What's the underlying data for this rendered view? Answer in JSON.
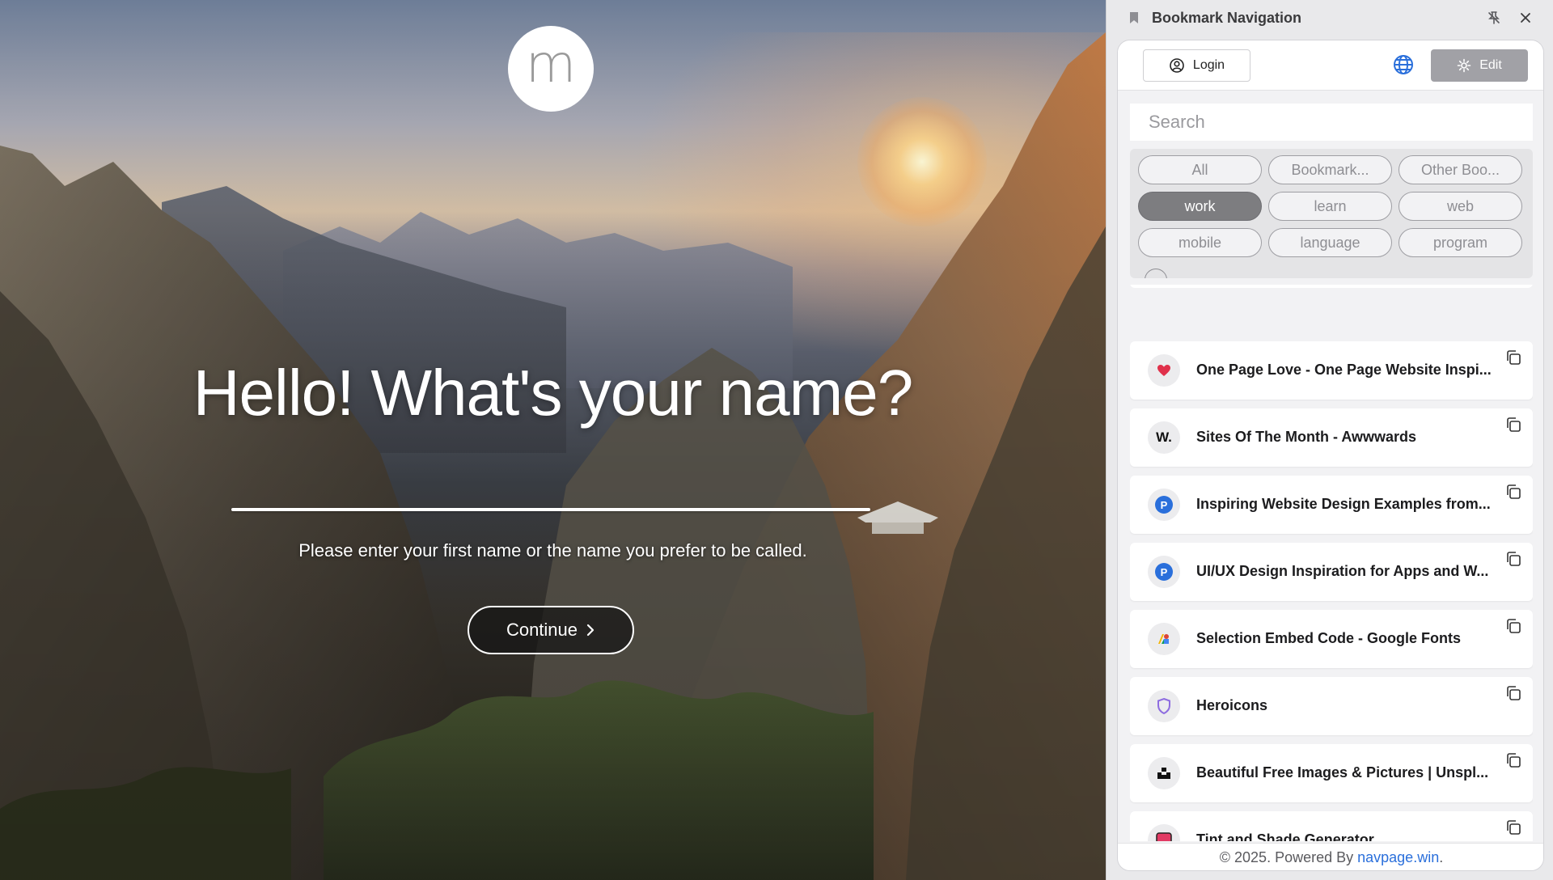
{
  "colors": {
    "accent_blue": "#2a6fdb",
    "active_tag_bg": "#7d7d80",
    "edit_button_bg": "#a1a1a6",
    "panel_bg": "#f2f2f4"
  },
  "welcome": {
    "logo_letter": "m",
    "greeting": "Hello! What's your name?",
    "name_input_value": "",
    "hint": "Please enter your first name or the name you prefer to be called.",
    "continue_label": "Continue"
  },
  "panel": {
    "title": "Bookmark Navigation",
    "login_label": "Login",
    "edit_label": "Edit",
    "search_placeholder": "Search",
    "tags": [
      {
        "label": "All",
        "active": false
      },
      {
        "label": "Bookmark...",
        "active": false
      },
      {
        "label": "Other Boo...",
        "active": false
      },
      {
        "label": "work",
        "active": true
      },
      {
        "label": "learn",
        "active": false
      },
      {
        "label": "web",
        "active": false
      },
      {
        "label": "mobile",
        "active": false
      },
      {
        "label": "language",
        "active": false
      },
      {
        "label": "program",
        "active": false
      }
    ],
    "bookmarks": [
      {
        "title": "One Page Love - One Page Website Inspi...",
        "icon": "heart-icon"
      },
      {
        "title": "Sites Of The Month - Awwwards",
        "icon": "awwwards-w-icon",
        "icon_text": "W."
      },
      {
        "title": "Inspiring Website Design Examples from...",
        "icon": "p-badge-icon",
        "icon_text": "P"
      },
      {
        "title": "UI/UX Design Inspiration for Apps and W...",
        "icon": "p-badge-icon",
        "icon_text": "P"
      },
      {
        "title": "Selection Embed Code - Google Fonts",
        "icon": "google-fonts-icon"
      },
      {
        "title": "Heroicons",
        "icon": "shield-icon"
      },
      {
        "title": "Beautiful Free Images & Pictures | Unspl...",
        "icon": "unsplash-icon"
      },
      {
        "title": "Tint and Shade Generator",
        "icon": "color-square-icon"
      }
    ],
    "footer_text": "© 2025. Powered By ",
    "footer_link": "navpage.win",
    "footer_end": "."
  }
}
